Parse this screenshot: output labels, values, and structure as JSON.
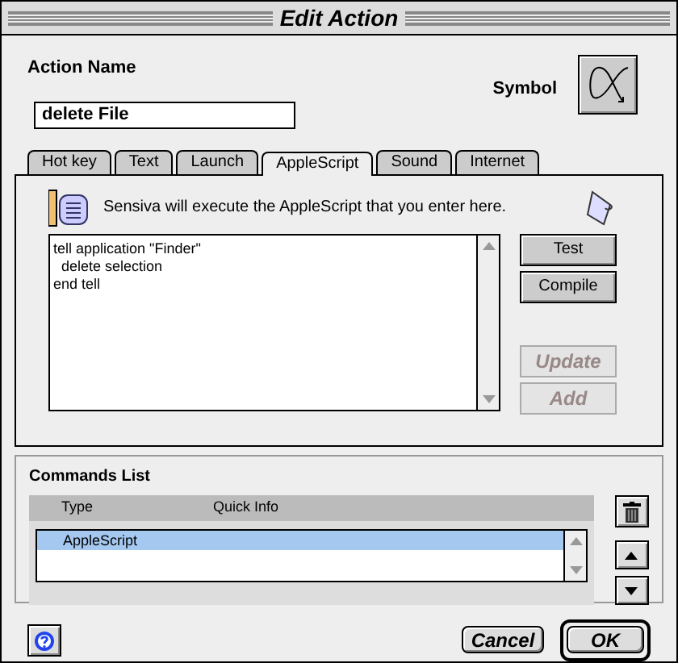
{
  "window": {
    "title": "Edit Action"
  },
  "action_name": {
    "label": "Action Name",
    "value": "delete File"
  },
  "symbol": {
    "label": "Symbol"
  },
  "tabs": [
    {
      "label": "Hot key",
      "selected": false
    },
    {
      "label": "Text",
      "selected": false
    },
    {
      "label": "Launch",
      "selected": false
    },
    {
      "label": "AppleScript",
      "selected": true
    },
    {
      "label": "Sound",
      "selected": false
    },
    {
      "label": "Internet",
      "selected": false
    }
  ],
  "panel": {
    "info": "Sensiva will execute the AppleScript that you enter here.",
    "script_lines": [
      "tell application \"Finder\"",
      "  delete selection",
      "end tell"
    ],
    "buttons": [
      {
        "label": "Test",
        "disabled": false
      },
      {
        "label": "Compile",
        "disabled": false
      },
      {
        "label": "Update",
        "disabled": true
      },
      {
        "label": "Add",
        "disabled": true
      }
    ]
  },
  "commands_list": {
    "title": "Commands List",
    "columns": [
      "Type",
      "Quick Info"
    ],
    "rows": [
      {
        "type": "AppleScript",
        "selected": true
      }
    ]
  },
  "footer_buttons": [
    {
      "label": "Cancel",
      "default": false
    },
    {
      "label": "OK",
      "default": true
    }
  ]
}
